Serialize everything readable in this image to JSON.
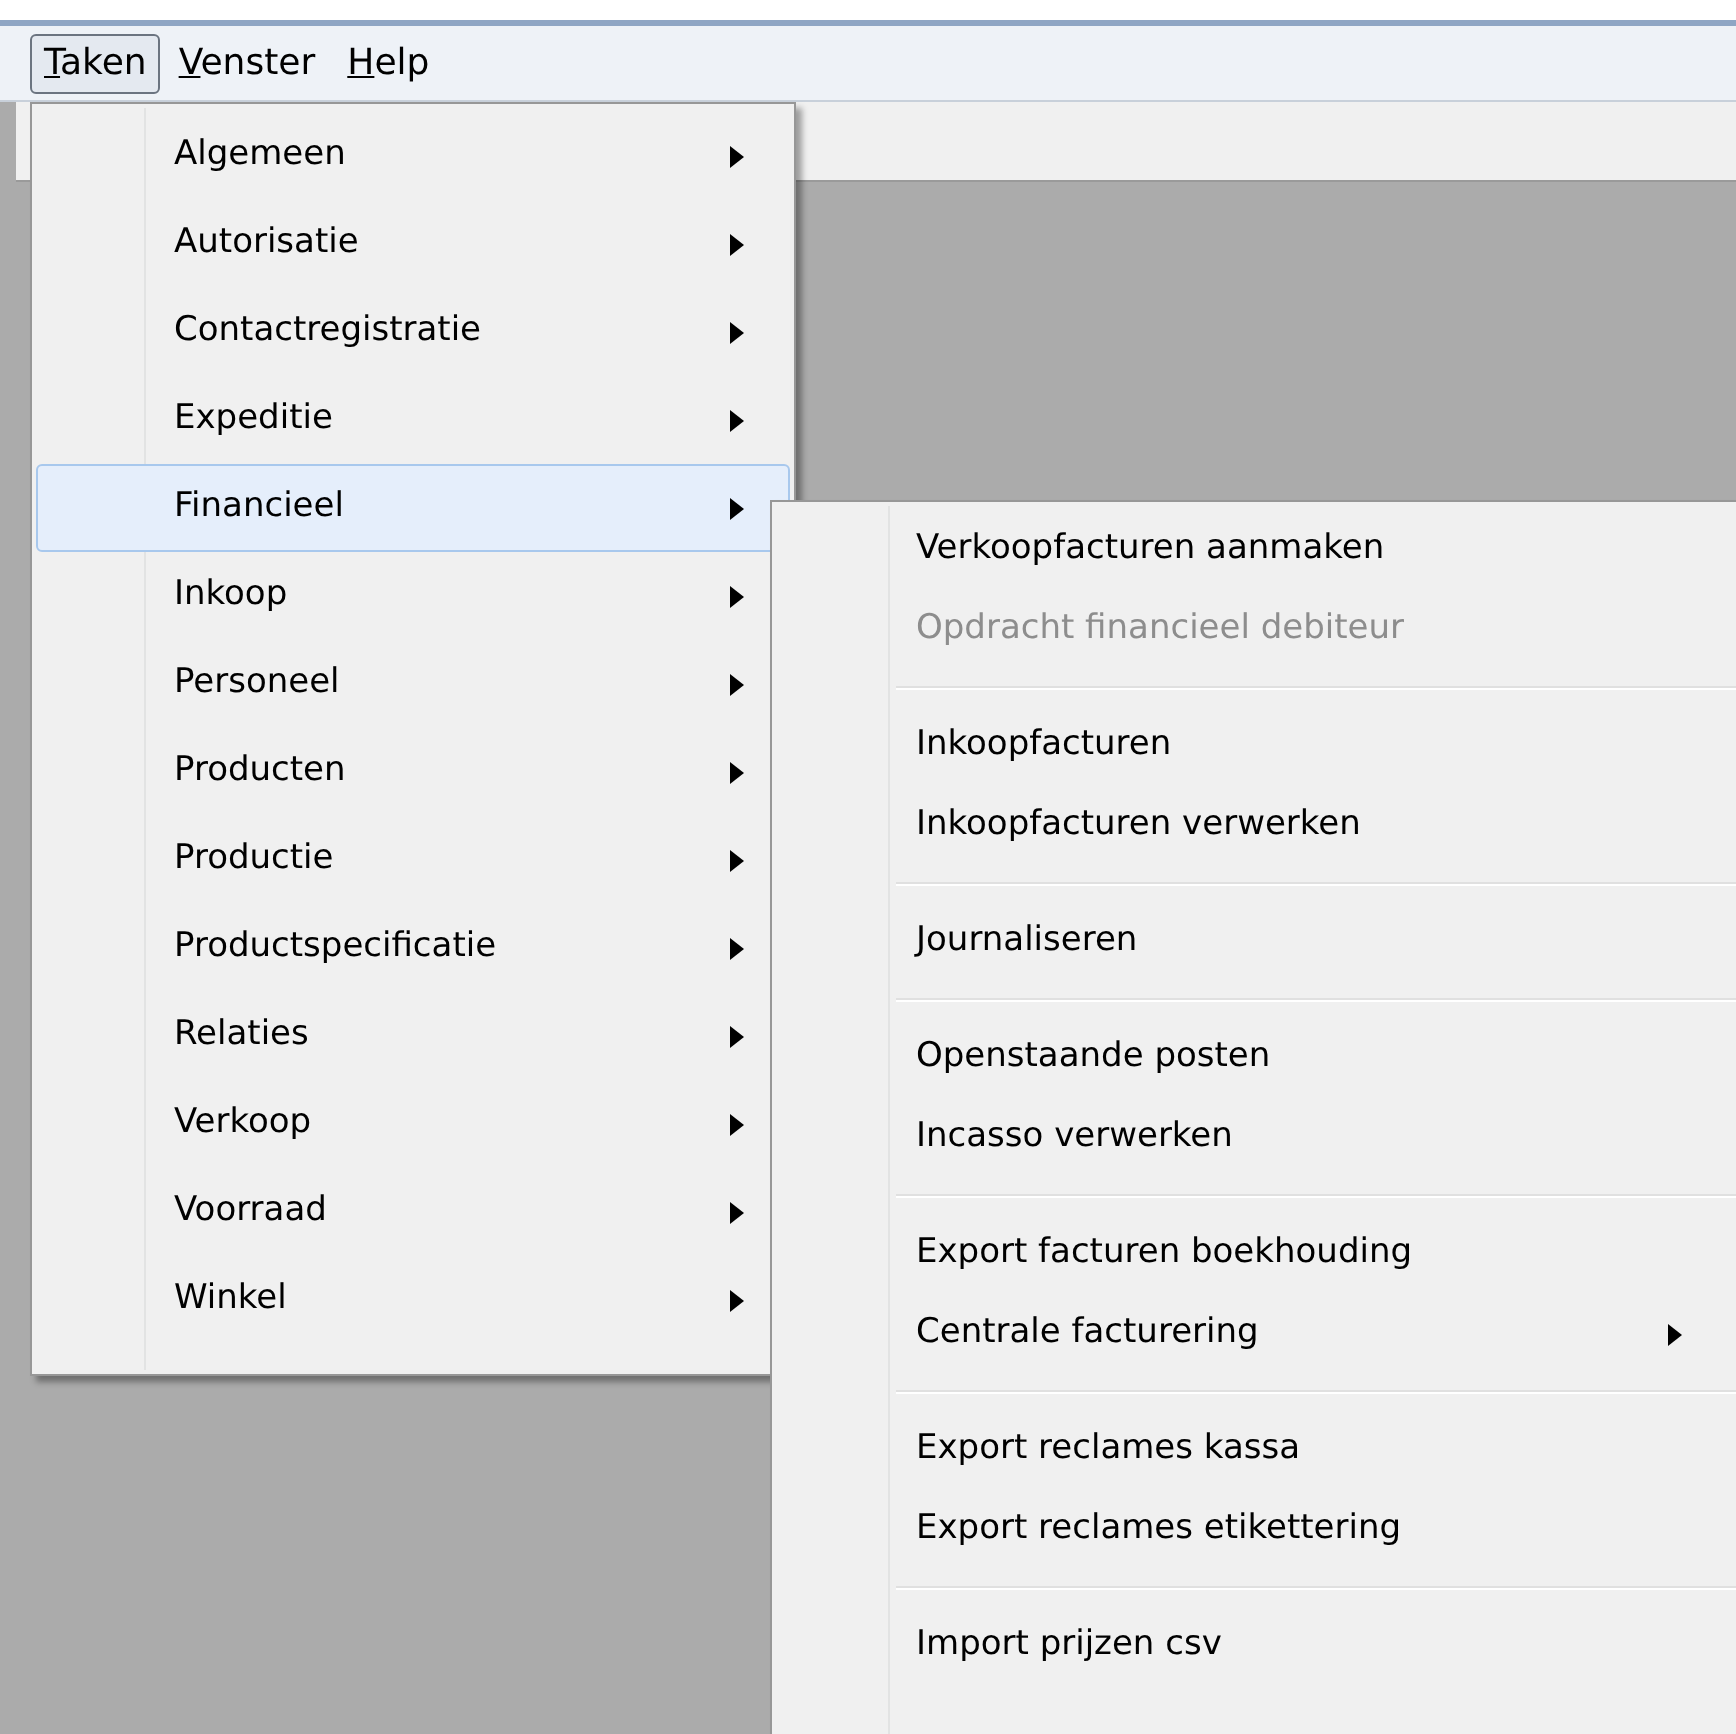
{
  "menubar": [
    {
      "accel": "T",
      "rest": "aken",
      "selected": true
    },
    {
      "accel": "V",
      "rest": "enster",
      "selected": false
    },
    {
      "accel": "H",
      "rest": "elp",
      "selected": false
    }
  ],
  "menu": {
    "items": [
      {
        "label": "Algemeen",
        "submenu": true,
        "selected": false
      },
      {
        "label": "Autorisatie",
        "submenu": true,
        "selected": false
      },
      {
        "label": "Contactregistratie",
        "submenu": true,
        "selected": false
      },
      {
        "label": "Expeditie",
        "submenu": true,
        "selected": false
      },
      {
        "label": "Financieel",
        "submenu": true,
        "selected": true
      },
      {
        "label": "Inkoop",
        "submenu": true,
        "selected": false
      },
      {
        "label": "Personeel",
        "submenu": true,
        "selected": false
      },
      {
        "label": "Producten",
        "submenu": true,
        "selected": false
      },
      {
        "label": "Productie",
        "submenu": true,
        "selected": false
      },
      {
        "label": "Productspecificatie",
        "submenu": true,
        "selected": false
      },
      {
        "label": "Relaties",
        "submenu": true,
        "selected": false
      },
      {
        "label": "Verkoop",
        "submenu": true,
        "selected": false
      },
      {
        "label": "Voorraad",
        "submenu": true,
        "selected": false
      },
      {
        "label": "Winkel",
        "submenu": true,
        "selected": false
      }
    ]
  },
  "submenu": {
    "items": [
      {
        "kind": "item",
        "label": "Verkoopfacturen aanmaken",
        "disabled": false,
        "submenu": false
      },
      {
        "kind": "item",
        "label": "Opdracht financieel debiteur",
        "disabled": true,
        "submenu": false
      },
      {
        "kind": "separator"
      },
      {
        "kind": "item",
        "label": "Inkoopfacturen",
        "disabled": false,
        "submenu": false
      },
      {
        "kind": "item",
        "label": "Inkoopfacturen verwerken",
        "disabled": false,
        "submenu": false
      },
      {
        "kind": "separator"
      },
      {
        "kind": "item",
        "label": "Journaliseren",
        "disabled": false,
        "submenu": false
      },
      {
        "kind": "separator"
      },
      {
        "kind": "item",
        "label": "Openstaande posten",
        "disabled": false,
        "submenu": false
      },
      {
        "kind": "item",
        "label": "Incasso verwerken",
        "disabled": false,
        "submenu": false
      },
      {
        "kind": "separator"
      },
      {
        "kind": "item",
        "label": "Export facturen boekhouding",
        "disabled": false,
        "submenu": false
      },
      {
        "kind": "item",
        "label": "Centrale facturering",
        "disabled": false,
        "submenu": true
      },
      {
        "kind": "separator"
      },
      {
        "kind": "item",
        "label": "Export reclames kassa",
        "disabled": false,
        "submenu": false
      },
      {
        "kind": "item",
        "label": "Export reclames etikettering",
        "disabled": false,
        "submenu": false
      },
      {
        "kind": "separator"
      },
      {
        "kind": "item",
        "label": "Import prijzen csv",
        "disabled": false,
        "submenu": false
      }
    ]
  }
}
